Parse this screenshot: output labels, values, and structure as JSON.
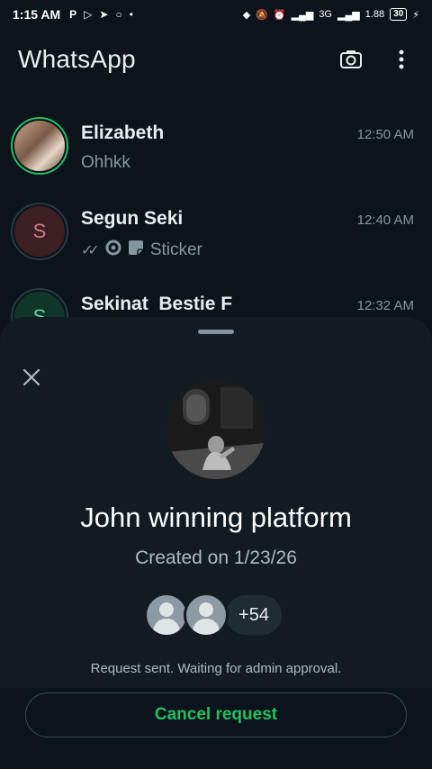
{
  "status_bar": {
    "time": "1:15 AM",
    "left_icons": [
      "P",
      "▷",
      "➤",
      "○",
      "•"
    ],
    "network": "3G",
    "data_speed": "1.88",
    "battery": "30"
  },
  "header": {
    "title": "WhatsApp"
  },
  "chats": [
    {
      "name": "Elizabeth",
      "time": "12:50 AM",
      "preview": "Ohhkk",
      "avatar": "photo",
      "story": true
    },
    {
      "name": "Segun Seki",
      "time": "12:40 AM",
      "preview": "Sticker",
      "avatar": "S",
      "story": false
    },
    {
      "name": "Sekinat  Bestie F",
      "time": "12:32 AM",
      "preview": "",
      "avatar": "S",
      "story": false
    }
  ],
  "sheet": {
    "group_name": "John winning platform",
    "created": "Created on 1/23/26",
    "more_members": "+54",
    "request_status": "Request sent. Waiting for admin approval.",
    "cancel_label": "Cancel request"
  },
  "colors": {
    "accent": "#21c063",
    "background": "#0b141a",
    "sheet": "#121b22",
    "muted": "#8696a0"
  }
}
